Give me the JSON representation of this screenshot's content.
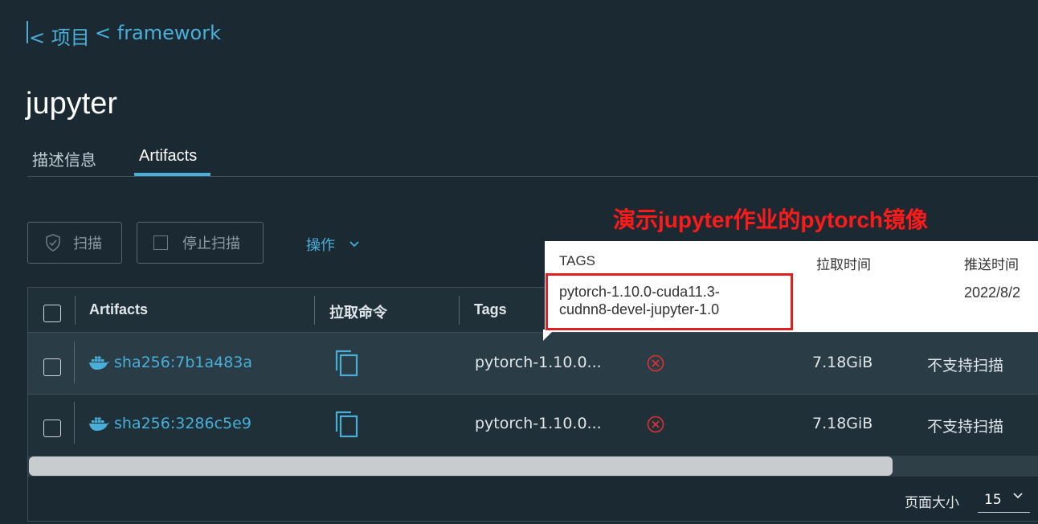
{
  "breadcrumb": {
    "back_label": "< 项目",
    "current_label": "< framework"
  },
  "page": {
    "title": "jupyter"
  },
  "tabs": [
    {
      "label": "描述信息"
    },
    {
      "label": "Artifacts"
    }
  ],
  "toolbar": {
    "scan_label": "扫描",
    "stop_scan_label": "停止扫描",
    "actions_label": "操作"
  },
  "table": {
    "headers": {
      "artifacts": "Artifacts",
      "pull_command": "拉取命令",
      "tags": "Tags"
    },
    "rows": [
      {
        "digest": "sha256:7b1a483a",
        "tags": "pytorch-1.10.0...",
        "size": "7.18GiB",
        "vulnerabilities": "不支持扫描"
      },
      {
        "digest": "sha256:3286c5e9",
        "tags": "pytorch-1.10.0...",
        "size": "7.18GiB",
        "vulnerabilities": "不支持扫描"
      }
    ]
  },
  "footer": {
    "page_size_label": "页面大小",
    "page_size_value": "15"
  },
  "popover": {
    "headers": {
      "tags": "TAGS",
      "pull_time": "拉取时间",
      "push_time": "推送时间"
    },
    "tag_line1": "pytorch-1.10.0-cuda11.3-",
    "tag_line2": "cudnn8-devel-jupyter-1.0",
    "push_time": "2022/8/2"
  },
  "annotation": {
    "text": "演示jupyter作业的pytorch镜像",
    "color": "#ff1a1a"
  },
  "colors": {
    "accent": "#49afd9",
    "background": "#1b2a32",
    "error": "#e0312f"
  }
}
